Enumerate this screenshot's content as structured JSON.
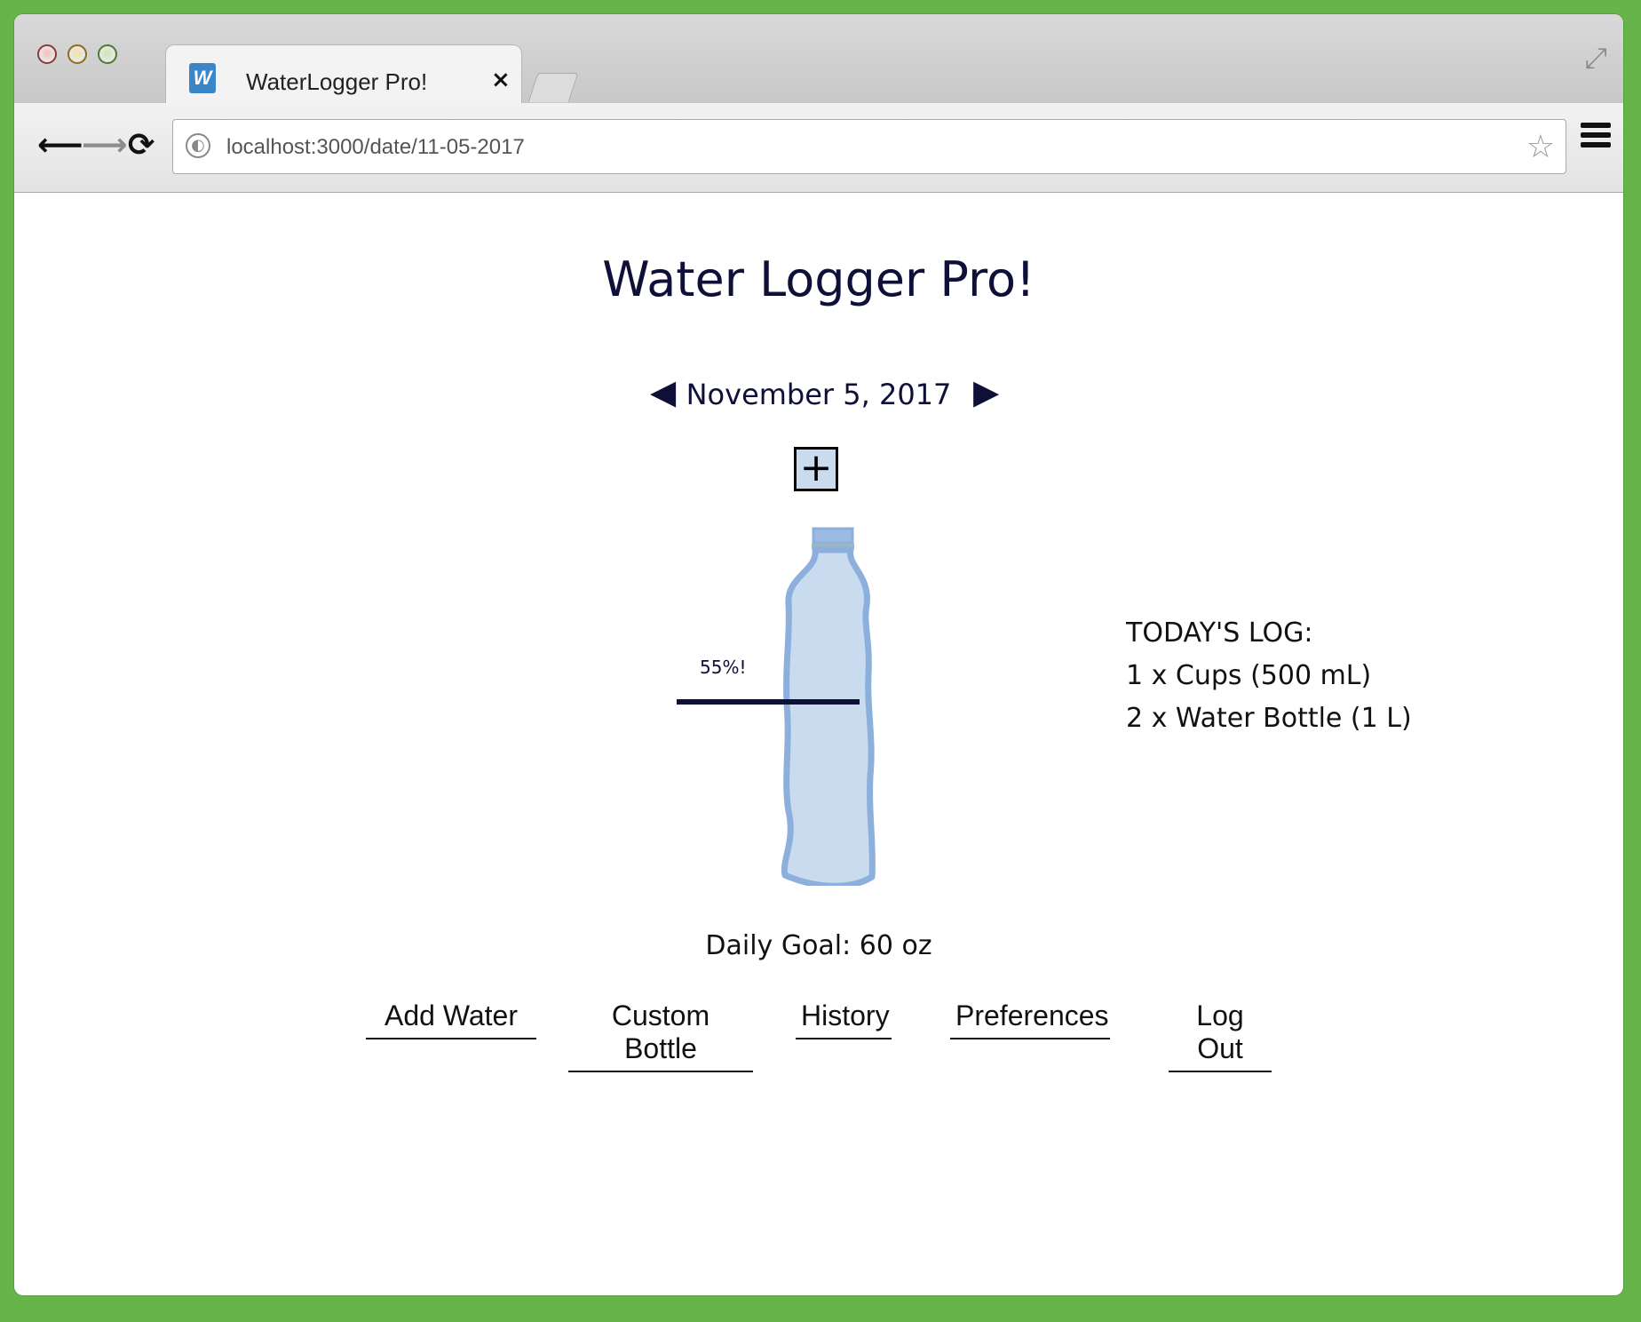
{
  "browser": {
    "tab_title": "WaterLogger Pro!",
    "favicon_letter": "W",
    "close_glyph": "×",
    "url": "localhost:3000/date/11-05-2017"
  },
  "app": {
    "title": "Water Logger Pro!",
    "date": "November 5, 2017",
    "add_glyph": "+",
    "progress_label": "55%!",
    "progress_fraction": 0.55,
    "log_heading": "TODAY'S LOG:",
    "log_items": [
      "1 x Cups (500 mL)",
      "2 x Water Bottle (1 L)"
    ],
    "daily_goal": "Daily Goal: 60 oz",
    "nav": [
      "Add Water",
      "Custom Bottle",
      "History",
      "Preferences",
      "Log Out"
    ]
  },
  "colors": {
    "background": "#67b44b",
    "text": "#0f1038",
    "bottle_fill": "#c9dcef",
    "bottle_outline": "#8cafdc"
  }
}
